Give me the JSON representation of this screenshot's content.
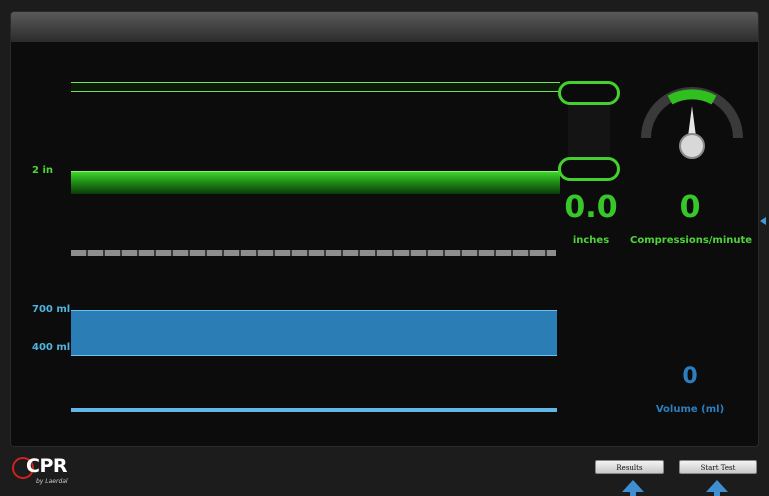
{
  "depth": {
    "target_label": "2 in",
    "value": "0.0",
    "unit": "inches"
  },
  "rate": {
    "value": "0",
    "unit": "Compressions/minute",
    "gauge_level": 0
  },
  "volume": {
    "upper_label": "700 ml",
    "lower_label": "400 ml",
    "value": "0",
    "unit": "Volume (ml)"
  },
  "logo": {
    "main": "CPR",
    "sub": "by Laerdal"
  },
  "buttons": {
    "results": "Results",
    "start_test": "Start Test"
  },
  "colors": {
    "depth_green": "#38c72a",
    "volume_blue": "#2a7db5",
    "accent_blue": "#3f8ed1",
    "logo_red": "#d02020"
  },
  "icons": [
    "gauge-icon",
    "arrow-up-icon",
    "arrow-left-icon"
  ]
}
